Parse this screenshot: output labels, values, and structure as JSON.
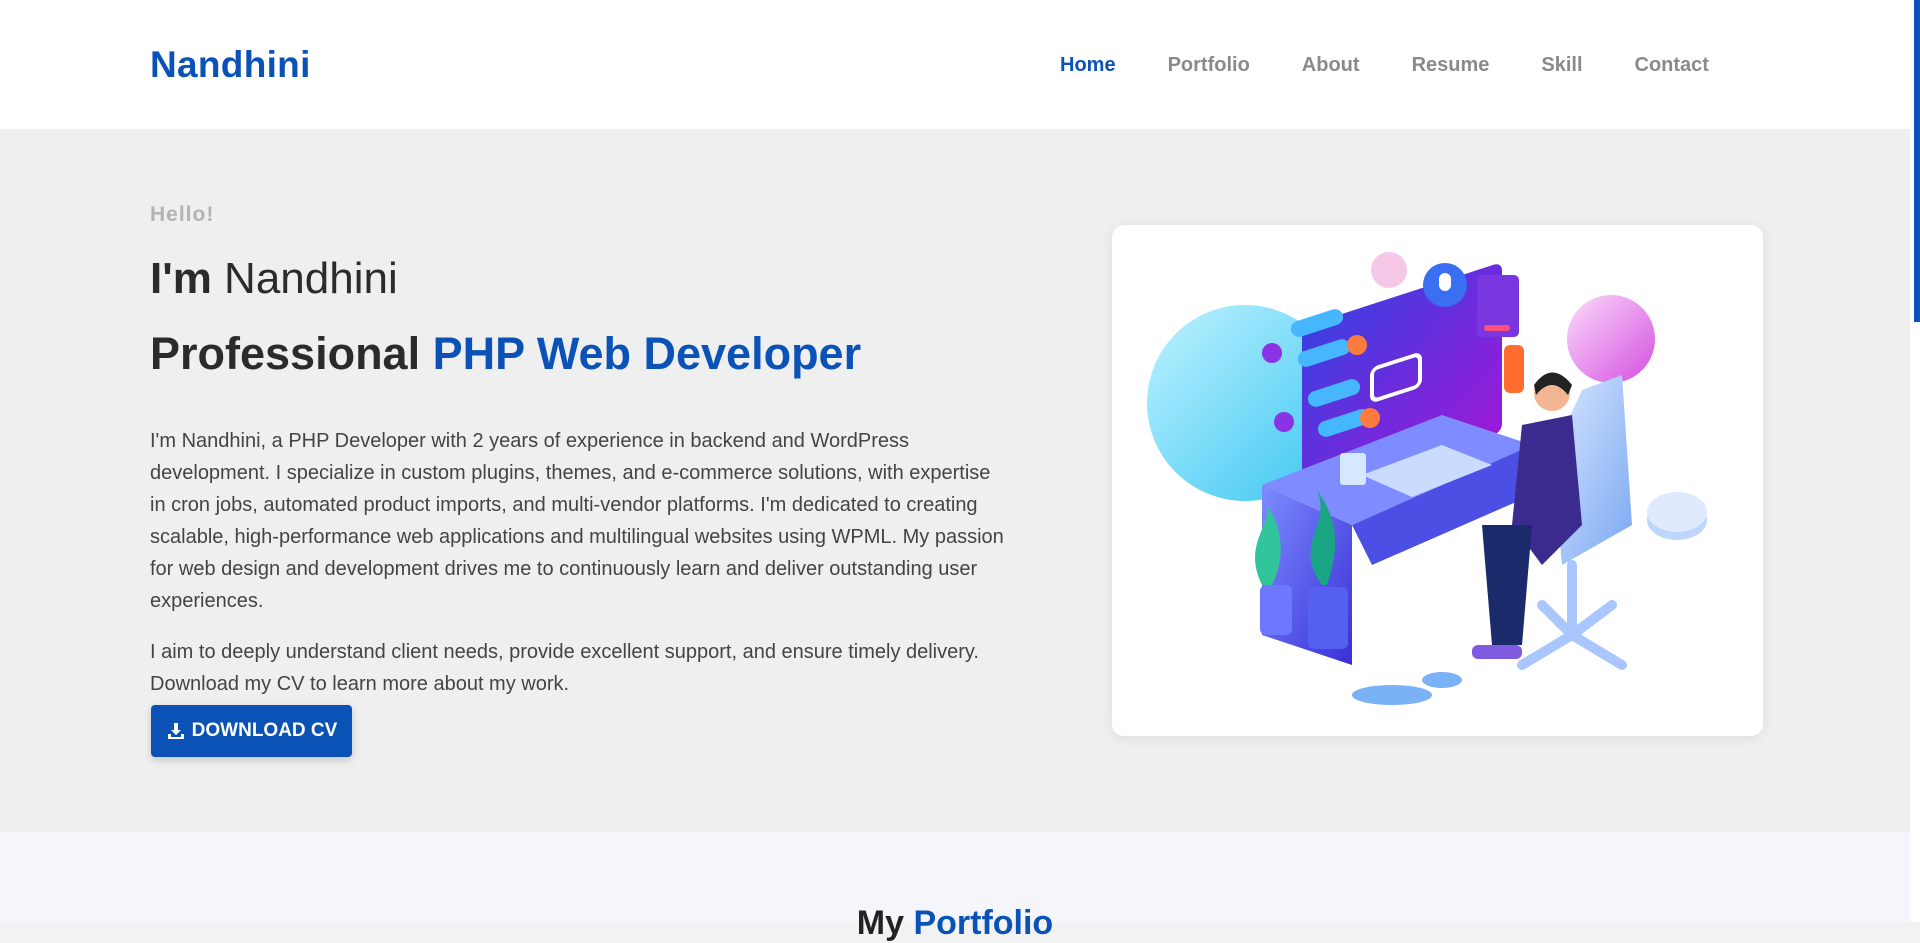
{
  "nav": {
    "brand": "Nandhini",
    "items": [
      "Home",
      "Portfolio",
      "About",
      "Resume",
      "Skill",
      "Contact"
    ],
    "active": "Home"
  },
  "hero": {
    "greeting": "Hello!",
    "intro_prefix": "I'm",
    "intro_name": "Nandhini",
    "role_prefix": "Professional",
    "role_highlight": "PHP Web Developer",
    "paragraph1": "I'm Nandhini, a PHP Developer with 2 years of experience in backend and WordPress development. I specialize in custom plugins, themes, and e-commerce solutions, with expertise in cron jobs, automated product imports, and multi-vendor platforms. I'm dedicated to creating scalable, high-performance web applications and multilingual websites using WPML. My passion for web design and development drives me to continuously learn and deliver outstanding user experiences.",
    "paragraph2": "I aim to deeply understand client needs, provide excellent support, and ensure timely delivery. Download my CV to learn more about my work.",
    "cv_button": "DOWNLOAD CV",
    "illustration_icon": "developer-desk-illustration"
  },
  "portfolio": {
    "title_prefix": "My",
    "title_highlight": "Portfolio"
  },
  "colors": {
    "accent": "#0a52b5",
    "muted": "#8a8a8a",
    "hero_bg": "#efefef"
  }
}
